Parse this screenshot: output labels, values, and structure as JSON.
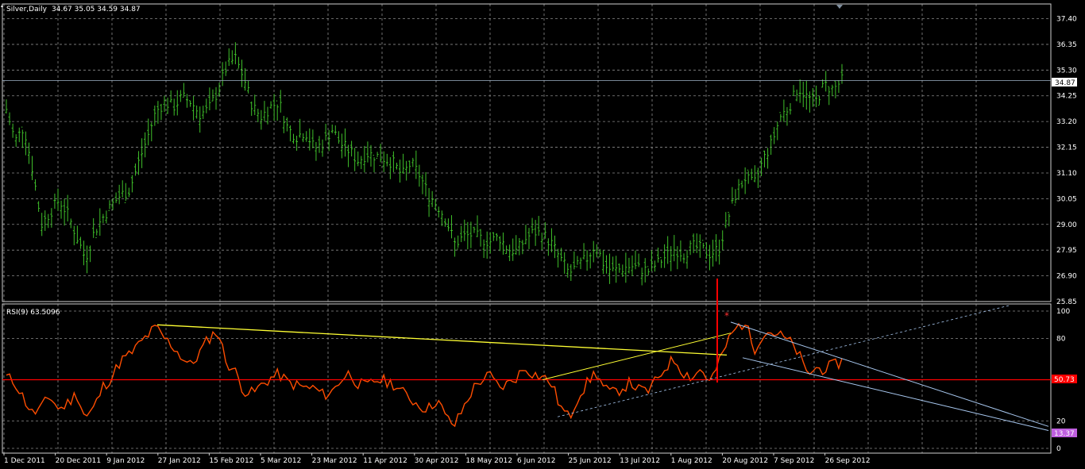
{
  "colors": {
    "background": "#000000",
    "grid": "#8a8a8a",
    "bars": "#3fbf2a",
    "rsi": "#ff4d00",
    "level_line": "#ff0000",
    "trend_yellow": "#ffff33",
    "trend_blue": "#a8c8f0",
    "price_line": "#a0b4c8",
    "volume_spike": "#ff0000"
  },
  "chart_data": [
    {
      "type": "ohlc",
      "title": "Silver,Daily",
      "ohlc_readout": "34.67 35.05 34.59 34.87",
      "current_price_label": "34.87",
      "ylim": [
        25.85,
        38.0
      ],
      "y_ticks": [
        "37.40",
        "36.35",
        "35.30",
        "34.25",
        "33.20",
        "32.15",
        "31.10",
        "30.05",
        "29.00",
        "27.95",
        "26.90",
        "25.85"
      ],
      "x_labels": [
        "1 Dec 2011",
        "20 Dec 2011",
        "9 Jan 2012",
        "27 Jan 2012",
        "15 Feb 2012",
        "5 Mar 2012",
        "23 Mar 2012",
        "11 Apr 2012",
        "30 Apr 2012",
        "18 May 2012",
        "6 Jun 2012",
        "25 Jun 2012",
        "13 Jul 2012",
        "1 Aug 2012",
        "20 Aug 2012",
        "7 Sep 2012",
        "26 Sep 2012"
      ],
      "closes": [
        33.7,
        32.4,
        33.0,
        31.2,
        29.0,
        29.5,
        30.0,
        29.4,
        28.5,
        27.6,
        28.7,
        29.3,
        29.8,
        30.2,
        30.4,
        31.5,
        32.5,
        33.6,
        34.0,
        33.8,
        34.2,
        34.0,
        33.5,
        33.7,
        34.4,
        35.4,
        35.8,
        35.0,
        33.8,
        33.4,
        33.8,
        34.0,
        32.9,
        32.6,
        32.8,
        32.1,
        32.3,
        32.9,
        32.3,
        32.0,
        31.6,
        31.9,
        31.8,
        31.7,
        31.5,
        31.0,
        31.5,
        31.0,
        30.2,
        29.8,
        29.2,
        28.2,
        28.5,
        28.6,
        28.4,
        28.3,
        28.5,
        28.0,
        27.9,
        28.4,
        28.7,
        28.6,
        28.2,
        27.6,
        27.0,
        27.3,
        27.6,
        28.2,
        27.3,
        27.1,
        27.2,
        27.3,
        27.2,
        27.1,
        27.4,
        27.7,
        28.0,
        27.8,
        28.1,
        28.0,
        27.8,
        28.0,
        29.2,
        30.3,
        30.9,
        30.6,
        31.6,
        32.3,
        33.4,
        33.8,
        34.6,
        34.2,
        34.0,
        34.7,
        34.5,
        34.87
      ],
      "overlay_text": ""
    },
    {
      "type": "line",
      "title": "RSI(9) 63.5096",
      "ylim": [
        0,
        100
      ],
      "y_ticks": [
        "100",
        "80",
        "20",
        "0"
      ],
      "level_label": "50.73",
      "min_label": "13.37",
      "rsi": [
        52,
        48,
        36,
        25,
        30,
        38,
        28,
        33,
        40,
        22,
        30,
        45,
        52,
        64,
        68,
        75,
        82,
        88,
        80,
        74,
        66,
        60,
        70,
        80,
        86,
        63,
        56,
        42,
        40,
        46,
        51,
        54,
        48,
        46,
        44,
        44,
        39,
        41,
        50,
        55,
        47,
        45,
        50,
        49,
        47,
        41,
        36,
        31,
        29,
        36,
        22,
        17,
        30,
        43,
        50,
        53,
        44,
        47,
        52,
        59,
        54,
        52,
        47,
        30,
        22,
        38,
        47,
        56,
        43,
        40,
        44,
        48,
        42,
        42,
        50,
        60,
        65,
        55,
        52,
        58,
        48,
        62,
        78,
        88,
        92,
        72,
        84,
        85,
        82,
        78,
        70,
        54,
        58,
        58,
        60,
        63.5
      ]
    }
  ]
}
